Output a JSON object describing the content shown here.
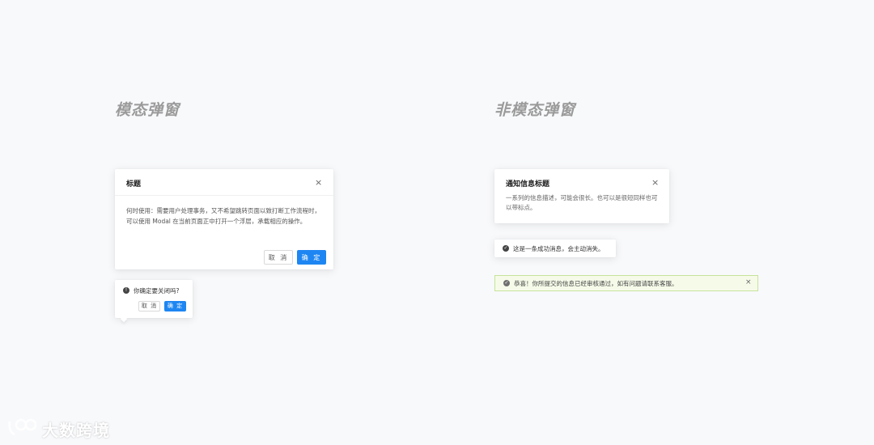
{
  "sections": {
    "modal_title": "模态弹窗",
    "non_modal_title": "非模态弹窗"
  },
  "modal": {
    "title": "标题",
    "close": "×",
    "body": "何时使用：需要用户处理事务，又不希望跳转页面以致打断工作流程时，可以使用 Modal 在当前页面正中打开一个浮层，承载相应的操作。",
    "cancel_label": "取 消",
    "ok_label": "确 定"
  },
  "popconfirm": {
    "message": "你确定要关闭吗?",
    "cancel_label": "取 消",
    "ok_label": "确 定"
  },
  "notification": {
    "title": "通知信息标题",
    "close": "×",
    "description": "一系列的信息描述，可能会很长。也可以是很短同样也可以带标点。"
  },
  "message": {
    "text": "这是一条成功消息，会主动消失。",
    "icon": "check-circle-icon"
  },
  "alert": {
    "text": "恭喜！你所提交的信息已经审核通过，如有问题请联系客服。",
    "close": "×",
    "icon": "check-circle-icon"
  },
  "watermark": {
    "text": "大数跨境"
  },
  "colors": {
    "primary": "#1e86f2",
    "alert_bg": "#f6fbe9",
    "alert_border": "#c6e39a"
  }
}
